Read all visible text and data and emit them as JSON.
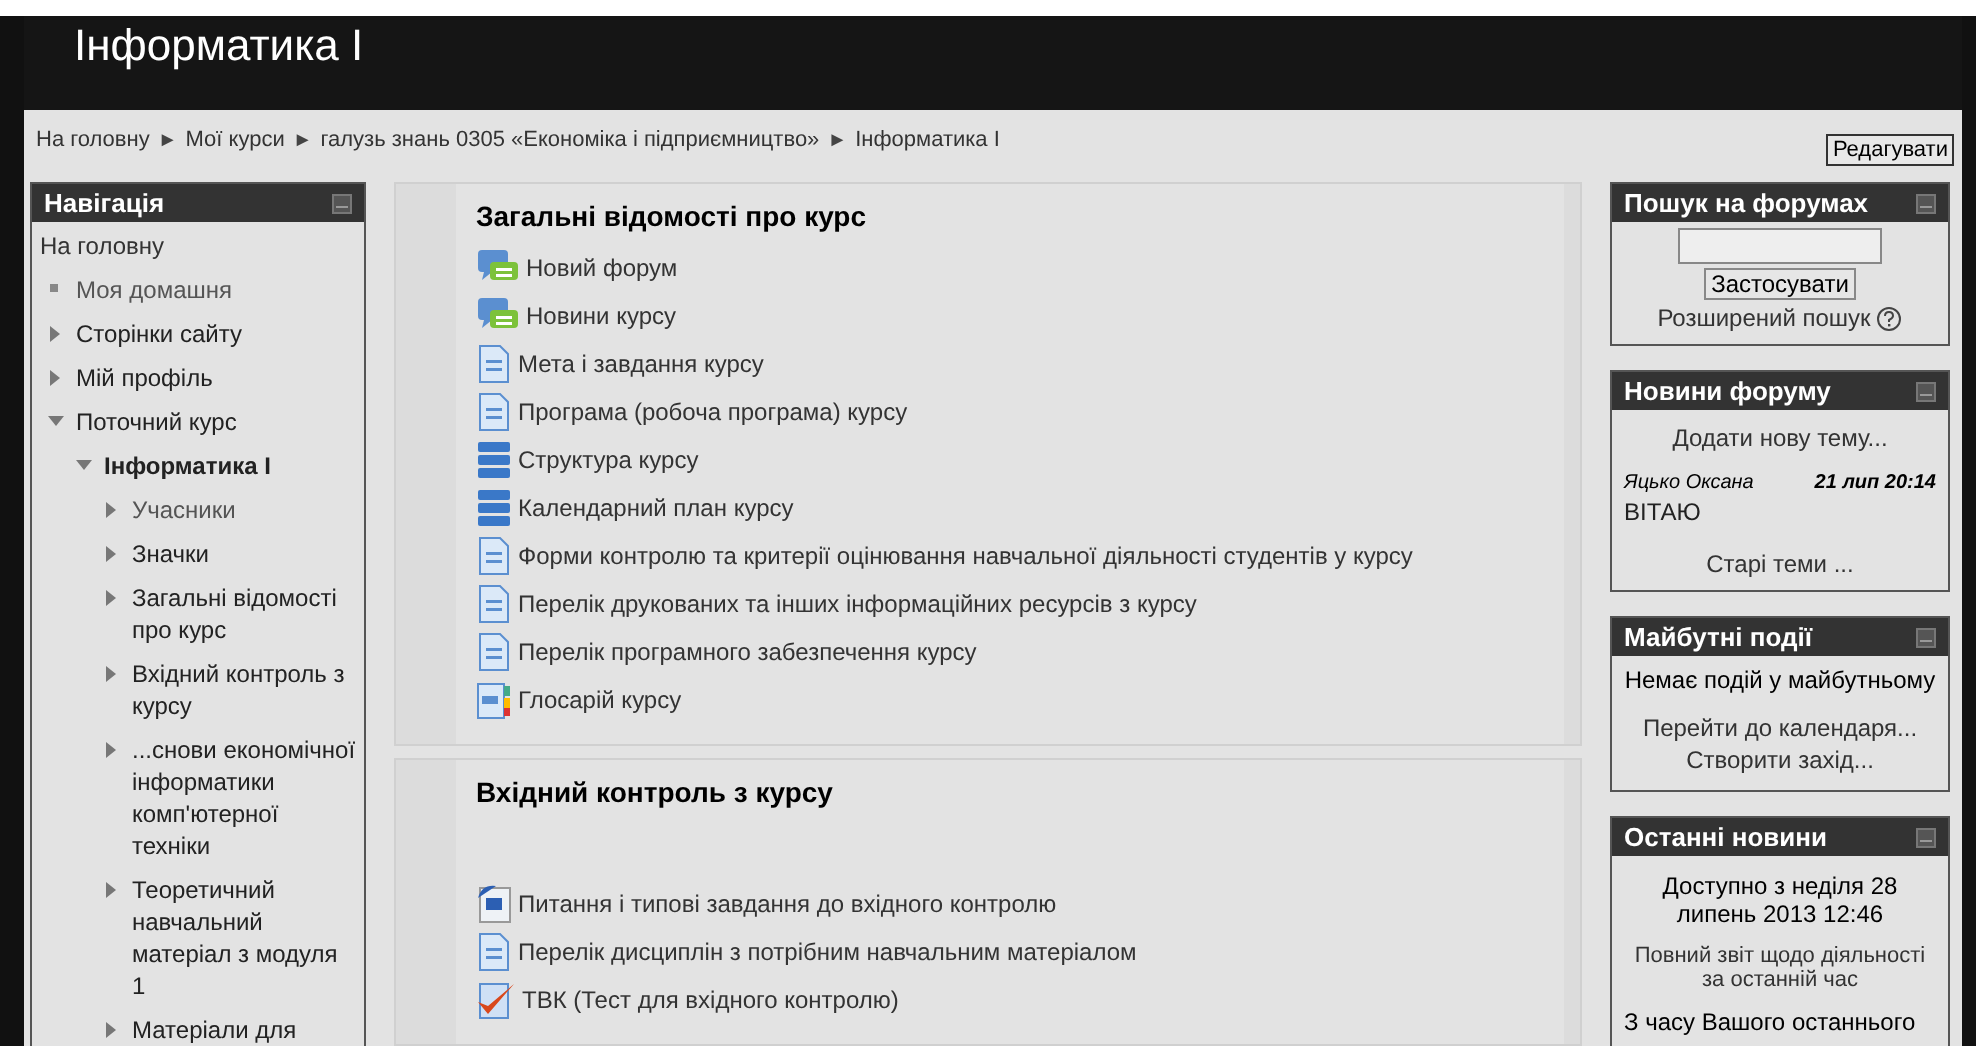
{
  "header": {
    "title": "Інформатика I"
  },
  "breadcrumb": {
    "items": [
      "На головну",
      "Мої курси",
      "галузь знань 0305 «Економіка і підприємництво»",
      "Інформатика I"
    ],
    "separator": "►"
  },
  "edit_button": "Редагувати",
  "navigation": {
    "title": "Навігація",
    "home": "На головну",
    "items": [
      {
        "label": "Моя домашня",
        "kind": "leaf",
        "dim": true
      },
      {
        "label": "Сторінки сайту",
        "kind": "branch",
        "expanded": false
      },
      {
        "label": "Мій профіль",
        "kind": "branch",
        "expanded": false
      },
      {
        "label": "Поточний курс",
        "kind": "branch",
        "expanded": true,
        "children": [
          {
            "label": "Інформатика I",
            "kind": "branch",
            "expanded": true,
            "bold": true,
            "children": [
              {
                "label": "Учасники",
                "kind": "branch",
                "expanded": false,
                "dim": true
              },
              {
                "label": "Значки",
                "kind": "branch",
                "expanded": false
              },
              {
                "label": "Загальні відомості про курс",
                "kind": "branch",
                "expanded": false
              },
              {
                "label": "Вхідний контроль з курсу",
                "kind": "branch",
                "expanded": false
              },
              {
                "label": "...снови економічної інформатики комп'ютерної техніки",
                "kind": "branch",
                "expanded": false
              },
              {
                "label": "Теоретичний навчальний матеріал з модуля 1",
                "kind": "branch",
                "expanded": false
              },
              {
                "label": "Матеріали для",
                "kind": "branch",
                "expanded": false
              }
            ]
          }
        ]
      }
    ]
  },
  "sections": [
    {
      "title": "Загальні відомості про курс",
      "spacer": false,
      "items": [
        {
          "kind": "forum",
          "label": "Новий форум"
        },
        {
          "kind": "forum",
          "label": "Новини курсу"
        },
        {
          "kind": "page",
          "label": "Мета і завдання курсу"
        },
        {
          "kind": "page",
          "label": "Програма (робоча програма) курсу"
        },
        {
          "kind": "book",
          "label": "Структура курсу"
        },
        {
          "kind": "book",
          "label": "Календарний план курсу"
        },
        {
          "kind": "page",
          "label": "Форми контролю та критерії оцінювання навчальної діяльності студентів у курсу"
        },
        {
          "kind": "page",
          "label": "Перелік друкованих та інших інформаційних ресурсів з курсу"
        },
        {
          "kind": "page",
          "label": "Перелік програмного забезпечення курсу"
        },
        {
          "kind": "glossary",
          "label": "Глосарій курсу"
        }
      ]
    },
    {
      "title": "Вхідний контроль з курсу",
      "spacer": true,
      "items": [
        {
          "kind": "word",
          "label": "Питання і типові завдання до вхідного контролю"
        },
        {
          "kind": "page",
          "label": "Перелік дисциплін з потрібним навчальним матеріалом"
        },
        {
          "kind": "quiz",
          "label": "ТВК (Тест для вхідного контролю)"
        }
      ]
    }
  ],
  "forum_search": {
    "title": "Пошук на форумах",
    "button": "Застосувати",
    "advanced": "Розширений пошук"
  },
  "forum_news": {
    "title": "Новини форуму",
    "add": "Додати нову тему...",
    "posts": [
      {
        "author": "Яцько Оксана",
        "date": "21 лип 20:14",
        "subject": "ВІТАЮ"
      }
    ],
    "older": "Старі теми ..."
  },
  "events": {
    "title": "Майбутні події",
    "empty": "Немає подій у майбутньому",
    "links": [
      "Перейти до календаря...",
      "Створити захід..."
    ]
  },
  "recent": {
    "title": "Останні новини",
    "since": "Доступно з неділя 28 липень 2013 12:46",
    "report": "Повний звіт щодо діяльності за останній час",
    "note": "З часу Вашого останнього"
  }
}
